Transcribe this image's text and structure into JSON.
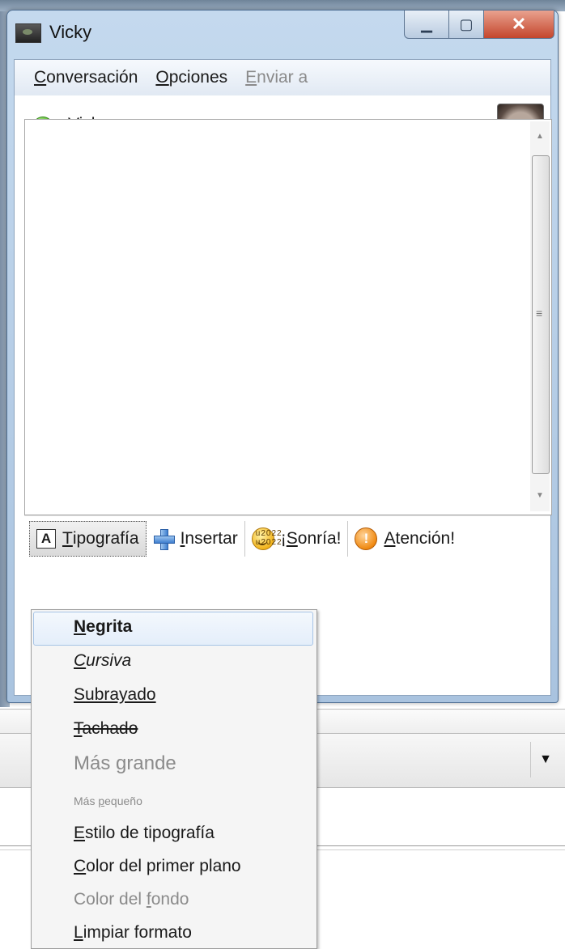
{
  "window": {
    "title": "Vicky"
  },
  "menubar": {
    "items": [
      {
        "label_u": "C",
        "label_rest": "onversación",
        "enabled": true
      },
      {
        "label_u": "O",
        "label_rest": "pciones",
        "enabled": true
      },
      {
        "label_u": "E",
        "label_rest": "nviar a",
        "enabled": false
      }
    ]
  },
  "contact": {
    "name": "Vicky",
    "status_color": "#55b52c"
  },
  "format_bar": {
    "typography": {
      "u": "T",
      "rest": "ipografía"
    },
    "insert": {
      "u": "I",
      "rest": "nsertar"
    },
    "smile": {
      "pre": "¡",
      "u": "S",
      "rest": "onría!"
    },
    "attention": {
      "u": "A",
      "rest": "tención!"
    }
  },
  "dropdown": {
    "items": [
      {
        "u": "N",
        "rest": "egrita",
        "style": "bold"
      },
      {
        "u": "C",
        "rest": "ursiva",
        "style": "italic"
      },
      {
        "u": "S",
        "rest": "ubrayado",
        "style": "underline"
      },
      {
        "u": "T",
        "rest": "achado",
        "style": "strike"
      },
      {
        "pre": "Más ",
        "u": "g",
        "rest": "rande",
        "style": "disabled-big"
      },
      {
        "pre": "Más ",
        "u": "p",
        "rest": "equeño",
        "style": "disabled-small"
      },
      {
        "u": "E",
        "rest": "stilo de tipografía",
        "style": "normal"
      },
      {
        "u": "C",
        "rest": "olor del primer plano",
        "style": "normal"
      },
      {
        "pre": "Color del ",
        "u": "f",
        "rest": "ondo",
        "style": "disabled"
      },
      {
        "u": "L",
        "rest": "impiar formato",
        "style": "normal"
      }
    ]
  },
  "colors": {
    "window_frame": "#a9c3df",
    "close_button": "#c4452c",
    "menu_highlight": "#e4eefa"
  }
}
